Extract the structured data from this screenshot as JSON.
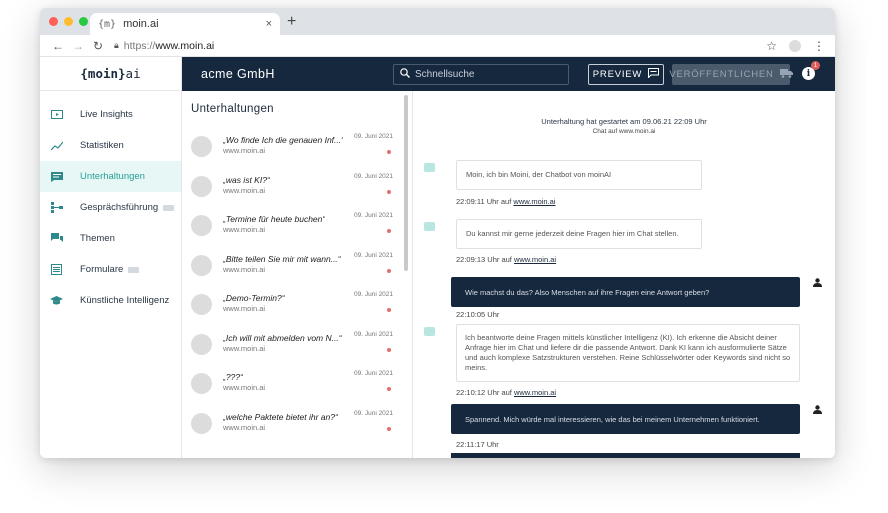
{
  "browser": {
    "tab_title": "moin.ai",
    "favicon": "{m}",
    "tab_close": "×",
    "new_tab": "+",
    "url_prefix": "https://",
    "url_domain": "www.moin.ai",
    "colors": {
      "close": "#fe5f57",
      "minimize": "#febc2e",
      "maximize": "#28c840"
    }
  },
  "logo": {
    "text_left": "{moin}",
    "text_right": "ai"
  },
  "topbar": {
    "company": "acme GmbH",
    "search_placeholder": "Schnellsuche",
    "preview_label": "PREVIEW",
    "publish_label": "VERÖFFENTLICHEN",
    "info_badge": "1"
  },
  "sidebar": {
    "items": [
      {
        "label": "Live Insights",
        "icon": "tv-icon"
      },
      {
        "label": "Statistiken",
        "icon": "trend-icon"
      },
      {
        "label": "Unterhaltungen",
        "icon": "chat-icon",
        "active": true
      },
      {
        "label": "Gesprächsführung",
        "icon": "flow-icon",
        "beta": true
      },
      {
        "label": "Themen",
        "icon": "topics-icon"
      },
      {
        "label": "Formulare",
        "icon": "form-icon",
        "beta": true
      },
      {
        "label": "Künstliche Intelligenz",
        "icon": "graduation-icon"
      }
    ]
  },
  "conversations": {
    "title": "Unterhaltungen",
    "items": [
      {
        "question": "„Wo finde Ich die genauen Inf...“",
        "source": "www.moin.ai",
        "date": "09. Juni 2021"
      },
      {
        "question": "„was ist KI?“",
        "source": "www.moin.ai",
        "date": "09. Juni 2021"
      },
      {
        "question": "„Termine für heute buchen“",
        "source": "www.moin.ai",
        "date": "09. Juni 2021"
      },
      {
        "question": "„Bitte teilen Sie mir mit wann...“",
        "source": "www.moin.ai",
        "date": "09. Juni 2021"
      },
      {
        "question": "„Demo-Termin?“",
        "source": "www.moin.ai",
        "date": "09. Juni 2021"
      },
      {
        "question": "„Ich will mit abmelden vom N...“",
        "source": "www.moin.ai",
        "date": "09. Juni 2021"
      },
      {
        "question": "„???“",
        "source": "www.moin.ai",
        "date": "09. Juni 2021"
      },
      {
        "question": "„welche Paktete bietet ihr an?“",
        "source": "www.moin.ai",
        "date": "09. Juni 2021"
      }
    ]
  },
  "chat": {
    "header_line1": "Unterhaltung hat gestartet am 09.06.21 22:09 Uhr",
    "header_line2": "Chat auf www.moin.ai",
    "messages": [
      {
        "from": "bot",
        "text": "Moin, ich bin Moini, der Chatbot von moinAI",
        "time": "22:09:11 Uhr auf",
        "site": "www.moin.ai"
      },
      {
        "from": "bot",
        "text": "Du kannst mir gerne jederzeit deine Fragen hier im Chat stellen.",
        "time": "22:09:13 Uhr auf",
        "site": "www.moin.ai"
      },
      {
        "from": "user",
        "text": "Wie machst du das? Also Menschen auf ihre Fragen eine Antwort geben?",
        "time": "22:10:05 Uhr"
      },
      {
        "from": "bot",
        "text": "Ich beantworte deine Fragen mittels künstlicher Intelligenz (KI). Ich erkenne die Absicht deiner Anfrage hier im Chat und liefere dir die passende Antwort. Dank KI kann ich ausformulierte Sätze und auch komplexe Satzstrukturen verstehen. Reine Schlüsselwörter oder Keywords sind nicht so meins.",
        "time": "22:10:12 Uhr auf",
        "site": "www.moin.ai"
      },
      {
        "from": "user",
        "text": "Spannend. Mich würde mal interessieren, wie das bei meinem Unternehmen funktioniert.",
        "time": "22:11:17 Uhr"
      }
    ]
  }
}
